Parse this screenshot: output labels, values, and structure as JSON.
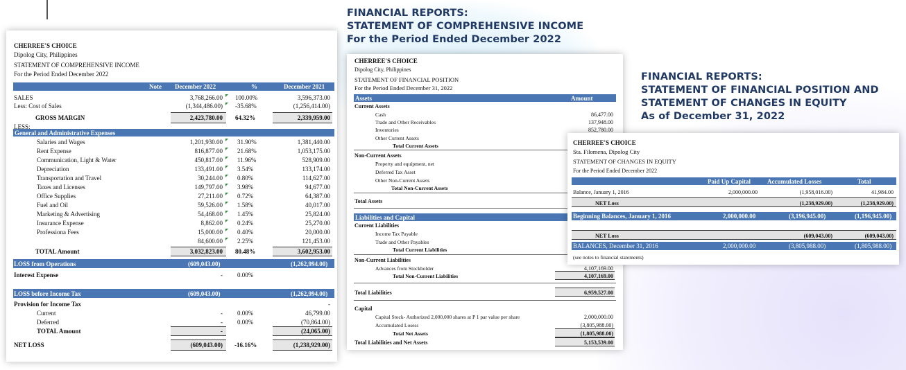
{
  "banner1": {
    "line1": "FINANCIAL REPORTS:",
    "line2": "STATEMENT OF COMPREHENSIVE INCOME",
    "line3": "For the Period Ended December 2022"
  },
  "banner2": {
    "line1": "FINANCIAL REPORTS:",
    "line2": "STATEMENT OF FINANCIAL POSITION AND",
    "line3": "STATEMENT OF CHANGES IN EQUITY",
    "line4": "As of December 31, 2022"
  },
  "income": {
    "company": "CHERREE'S CHOICE",
    "location": "Dipolog City, Philippines",
    "title": "STATEMENT OF COMPREHENSIVE INCOME",
    "period": "For the Period Ended December 2022",
    "columns": {
      "note": "Note",
      "dec2022": "December 2022",
      "pct": "%",
      "dec2021": "December 2021"
    },
    "sales": {
      "label": "SALES",
      "v2022": "3,768,266.00",
      "pct": "100.00%",
      "v2021": "3,596,373.00"
    },
    "cost": {
      "label": "Less: Cost of Sales",
      "v2022": "(1,344,486.00)",
      "pct": "-35.68%",
      "v2021": "(1,256,414.00)"
    },
    "gross": {
      "label": "GROSS MARGIN",
      "v2022": "2,423,780.00",
      "pct": "64.32%",
      "v2021": "2,339,959.00"
    },
    "less_label": "LESS:",
    "expenses_header": "General and Administrative Expenses",
    "expenses": [
      {
        "label": "Salaries and Wages",
        "v2022": "1,201,930.00",
        "pct": "31.90%",
        "v2021": "1,381,440.00"
      },
      {
        "label": "Rent Expense",
        "v2022": "816,877.00",
        "pct": "21.68%",
        "v2021": "1,053,175.00"
      },
      {
        "label": "Communication, Light & Water",
        "v2022": "450,817.00",
        "pct": "11.96%",
        "v2021": "528,909.00"
      },
      {
        "label": "Depreciation",
        "v2022": "133,491.00",
        "pct": "3.54%",
        "v2021": "133,174.00"
      },
      {
        "label": "Transportation and Travel",
        "v2022": "30,244.00",
        "pct": "0.80%",
        "v2021": "114,627.00"
      },
      {
        "label": "Taxes and Licenses",
        "v2022": "149,797.00",
        "pct": "3.98%",
        "v2021": "94,677.00"
      },
      {
        "label": "Office Supplies",
        "v2022": "27,211.00",
        "pct": "0.72%",
        "v2021": "64,387.00"
      },
      {
        "label": "Fuel and Oil",
        "v2022": "59,526.00",
        "pct": "1.58%",
        "v2021": "40,017.00"
      },
      {
        "label": "Marketing & Advertising",
        "v2022": "54,468.00",
        "pct": "1.45%",
        "v2021": "25,824.00"
      },
      {
        "label": "Insurance Expense",
        "v2022": "8,862.00",
        "pct": "0.24%",
        "v2021": "25,270.00"
      },
      {
        "label": "Professiona Fees",
        "v2022": "15,000.00",
        "pct": "0.40%",
        "v2021": "20,000.00"
      },
      {
        "label": "",
        "v2022": "84,600.00",
        "pct": "2.25%",
        "v2021": "121,453.00"
      }
    ],
    "total_amount": {
      "label": "TOTAL Amount",
      "v2022": "3,032,823.00",
      "pct": "80.48%",
      "v2021": "3,602,953.00"
    },
    "loss_ops": {
      "label": "LOSS from Operations",
      "v2022": "(609,043.00)",
      "v2021": "(1,262,994.00)"
    },
    "interest": {
      "label": "Interest Expense",
      "v2022": "-",
      "pct": "0.00%"
    },
    "loss_before": {
      "label": "LOSS before Income Tax",
      "v2022": "(609,043.00)",
      "v2021": "(1,262,994.00)"
    },
    "provision_label": "Provision for Income Tax",
    "provision_dash": "-",
    "current": {
      "label": "Current",
      "v2022": "-",
      "pct": "0.00%",
      "v2021": "46,799.00"
    },
    "deferred": {
      "label": "Deferred",
      "v2022": "-",
      "pct": "0.00%",
      "v2021": "(70,864.00)"
    },
    "tax_total": {
      "label": "TOTAL Amount",
      "v2022": "-",
      "v2021": "(24,065.00)"
    },
    "net_loss": {
      "label": "NET LOSS",
      "v2022": "(609,043.00)",
      "pct": "-16.16%",
      "v2021": "(1,238,929.00)"
    }
  },
  "position": {
    "company": "CHERREE'S CHOICE",
    "location": "Dipolog City, Philippines",
    "title": "STATEMENT OF FINANCIAL POSITION",
    "period": "For the Period Ended December 31, 2022",
    "col_assets": "Assets",
    "col_amount": "Amount",
    "current_assets": "Current Assets",
    "cash": {
      "label": "Cash",
      "value": "86,477.00"
    },
    "receivables": {
      "label": "Trade and Other Receivables",
      "value": "137,948.00"
    },
    "inventories": {
      "label": "Inventories",
      "value": "852,780.00"
    },
    "other_current": "Other Current Assets",
    "total_current": "Total Current Assets",
    "noncurrent_assets": "Non-Current Assets",
    "ppe1": "Property and equipment, net",
    "deferred_tax": "Deferred Tax Asset",
    "other_noncurrent": "Other Non-Current Assets",
    "total_noncurrent": "Total Non-Current Assets",
    "total_assets": "Total Assets",
    "liab_header": "Liabilities and Capital",
    "current_liab": "Current Liabilities",
    "income_tax_payable": "Income Tax Payable",
    "trade_payables": "Trade and Other Payables",
    "total_current_liab": "Total Current Liabilities",
    "noncurrent_liab": "Non-Current Liabilities",
    "advances": {
      "label": "Advances from Stockholder",
      "value": "4,107,169.00"
    },
    "total_noncurrent_liab": {
      "label": "Total Non-Current Liabilities",
      "value": "4,107,169.00"
    },
    "total_liab": {
      "label": "Total Liabilities",
      "value": "6,959,527.00"
    },
    "capital": "Capital",
    "capital_stock": {
      "label": "Capital Stock- Authorized 2,000,000 shares at P 1 par value per share",
      "value": "2,000,000.00"
    },
    "accum_losses": {
      "label": "Accumulated Losess",
      "value": "(3,805,988.00)"
    },
    "total_net_assets": {
      "label": "Total Net Assets",
      "value": "(1,805,988.00)"
    },
    "total_liab_net": {
      "label": "Total Liabilities and Net Assets",
      "value": "5,153,539.00"
    }
  },
  "equity": {
    "company": "CHERREE'S CHOICE",
    "location": "Sta. Filomena, Dipolog City",
    "title": "STATEMENT OF CHANGES IN EQUITY",
    "period": "For the Period Ended December 2022",
    "columns": {
      "paid_up": "Paid Up Capital",
      "accum": "Accumulated Losses",
      "total": "Total"
    },
    "balance_2016": {
      "label": "Balance, January 1, 2016",
      "paid_up": "2,000,000.00",
      "accum": "(1,958,016.00)",
      "total": "41,984.00"
    },
    "net_loss1": {
      "label": "NET Loss",
      "accum": "(1,238,929.00)",
      "total": "(1,238,929.00)"
    },
    "beginning": {
      "label": "Beginning Balances, January 1, 2016",
      "paid_up": "2,000,000.00",
      "accum": "(3,196,945.00)",
      "total": "(1,196,945.00)"
    },
    "net_loss2": {
      "label": "NET Loss",
      "accum": "(609,043.00)",
      "total": "(609,043.00)"
    },
    "ending": {
      "label": "BALANCES, December 31, 2016",
      "paid_up": "2,000,000.00",
      "accum": "(3,805,988.00)",
      "total": "(1,805,988.00)"
    },
    "note": "(see notes to financial statements)"
  }
}
